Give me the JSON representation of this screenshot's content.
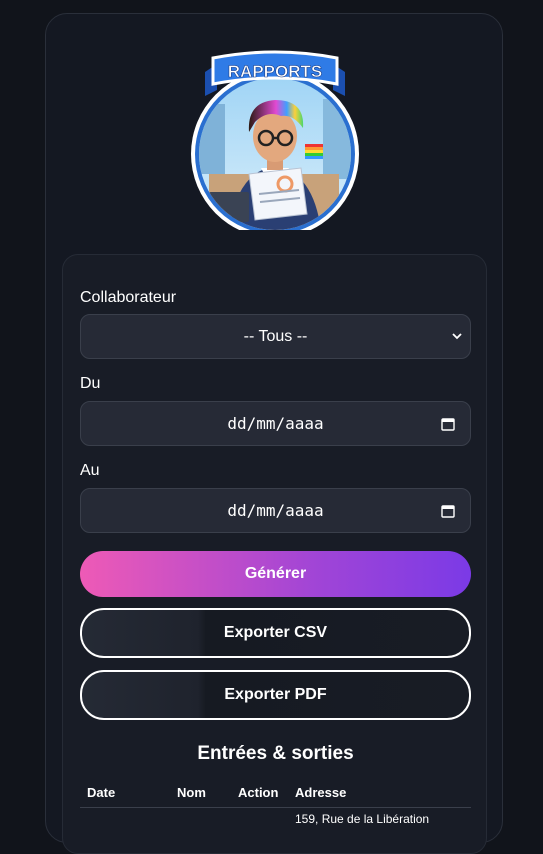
{
  "logo": {
    "banner_text": "RAPPORTS"
  },
  "form": {
    "collaborator": {
      "label": "Collaborateur",
      "selected": "-- Tous --"
    },
    "from": {
      "label": "Du",
      "placeholder": "dd/mm/aaaa"
    },
    "to": {
      "label": "Au",
      "placeholder": "dd/mm/aaaa"
    },
    "buttons": {
      "generate": "Générer",
      "export_csv": "Exporter CSV",
      "export_pdf": "Exporter PDF"
    }
  },
  "report": {
    "title": "Entrées & sorties",
    "columns": [
      "Date",
      "Nom",
      "Action",
      "Adresse"
    ],
    "rows": [
      {
        "date": "",
        "nom": "",
        "action": "",
        "adresse": "159, Rue de la Libération"
      }
    ]
  },
  "colors": {
    "accent_start": "#ee5ab6",
    "accent_end": "#7b3ae6",
    "background": "#11141b"
  },
  "icons": {
    "select": "chevron-down-icon",
    "date": "calendar-icon"
  }
}
